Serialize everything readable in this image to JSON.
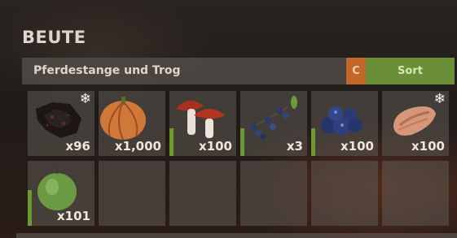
{
  "header": {
    "title": "BEUTE"
  },
  "container": {
    "name": "Pferdestange und Trog",
    "c_label": "C",
    "sort_label": "Sort"
  },
  "slots": [
    {
      "item": "charcoal",
      "icon": "charcoal-icon",
      "qty": "x96",
      "frozen": true,
      "condition": null
    },
    {
      "item": "pumpkin",
      "icon": "pumpkin-icon",
      "qty": "x1,000",
      "frozen": false,
      "condition": null
    },
    {
      "item": "mushroom",
      "icon": "mushroom-icon",
      "qty": "x100",
      "frozen": false,
      "condition": 0.42
    },
    {
      "item": "blue berry branch",
      "icon": "berry-branch-icon",
      "qty": "x3",
      "frozen": false,
      "condition": 0.42
    },
    {
      "item": "blueberries",
      "icon": "blueberries-icon",
      "qty": "x100",
      "frozen": false,
      "condition": 0.42
    },
    {
      "item": "raw meat",
      "icon": "meat-icon",
      "qty": "x100",
      "frozen": true,
      "condition": null
    },
    {
      "item": "apple",
      "icon": "apple-icon",
      "qty": "x101",
      "frozen": false,
      "condition": 0.55
    },
    {
      "item": null,
      "qty": null
    },
    {
      "item": null,
      "qty": null
    },
    {
      "item": null,
      "qty": null
    },
    {
      "item": null,
      "qty": null
    },
    {
      "item": null,
      "qty": null
    }
  ],
  "colors": {
    "c_button": "#c2682a",
    "sort_button": "#6b8f36",
    "condition_bar": "#6c9a2e"
  }
}
